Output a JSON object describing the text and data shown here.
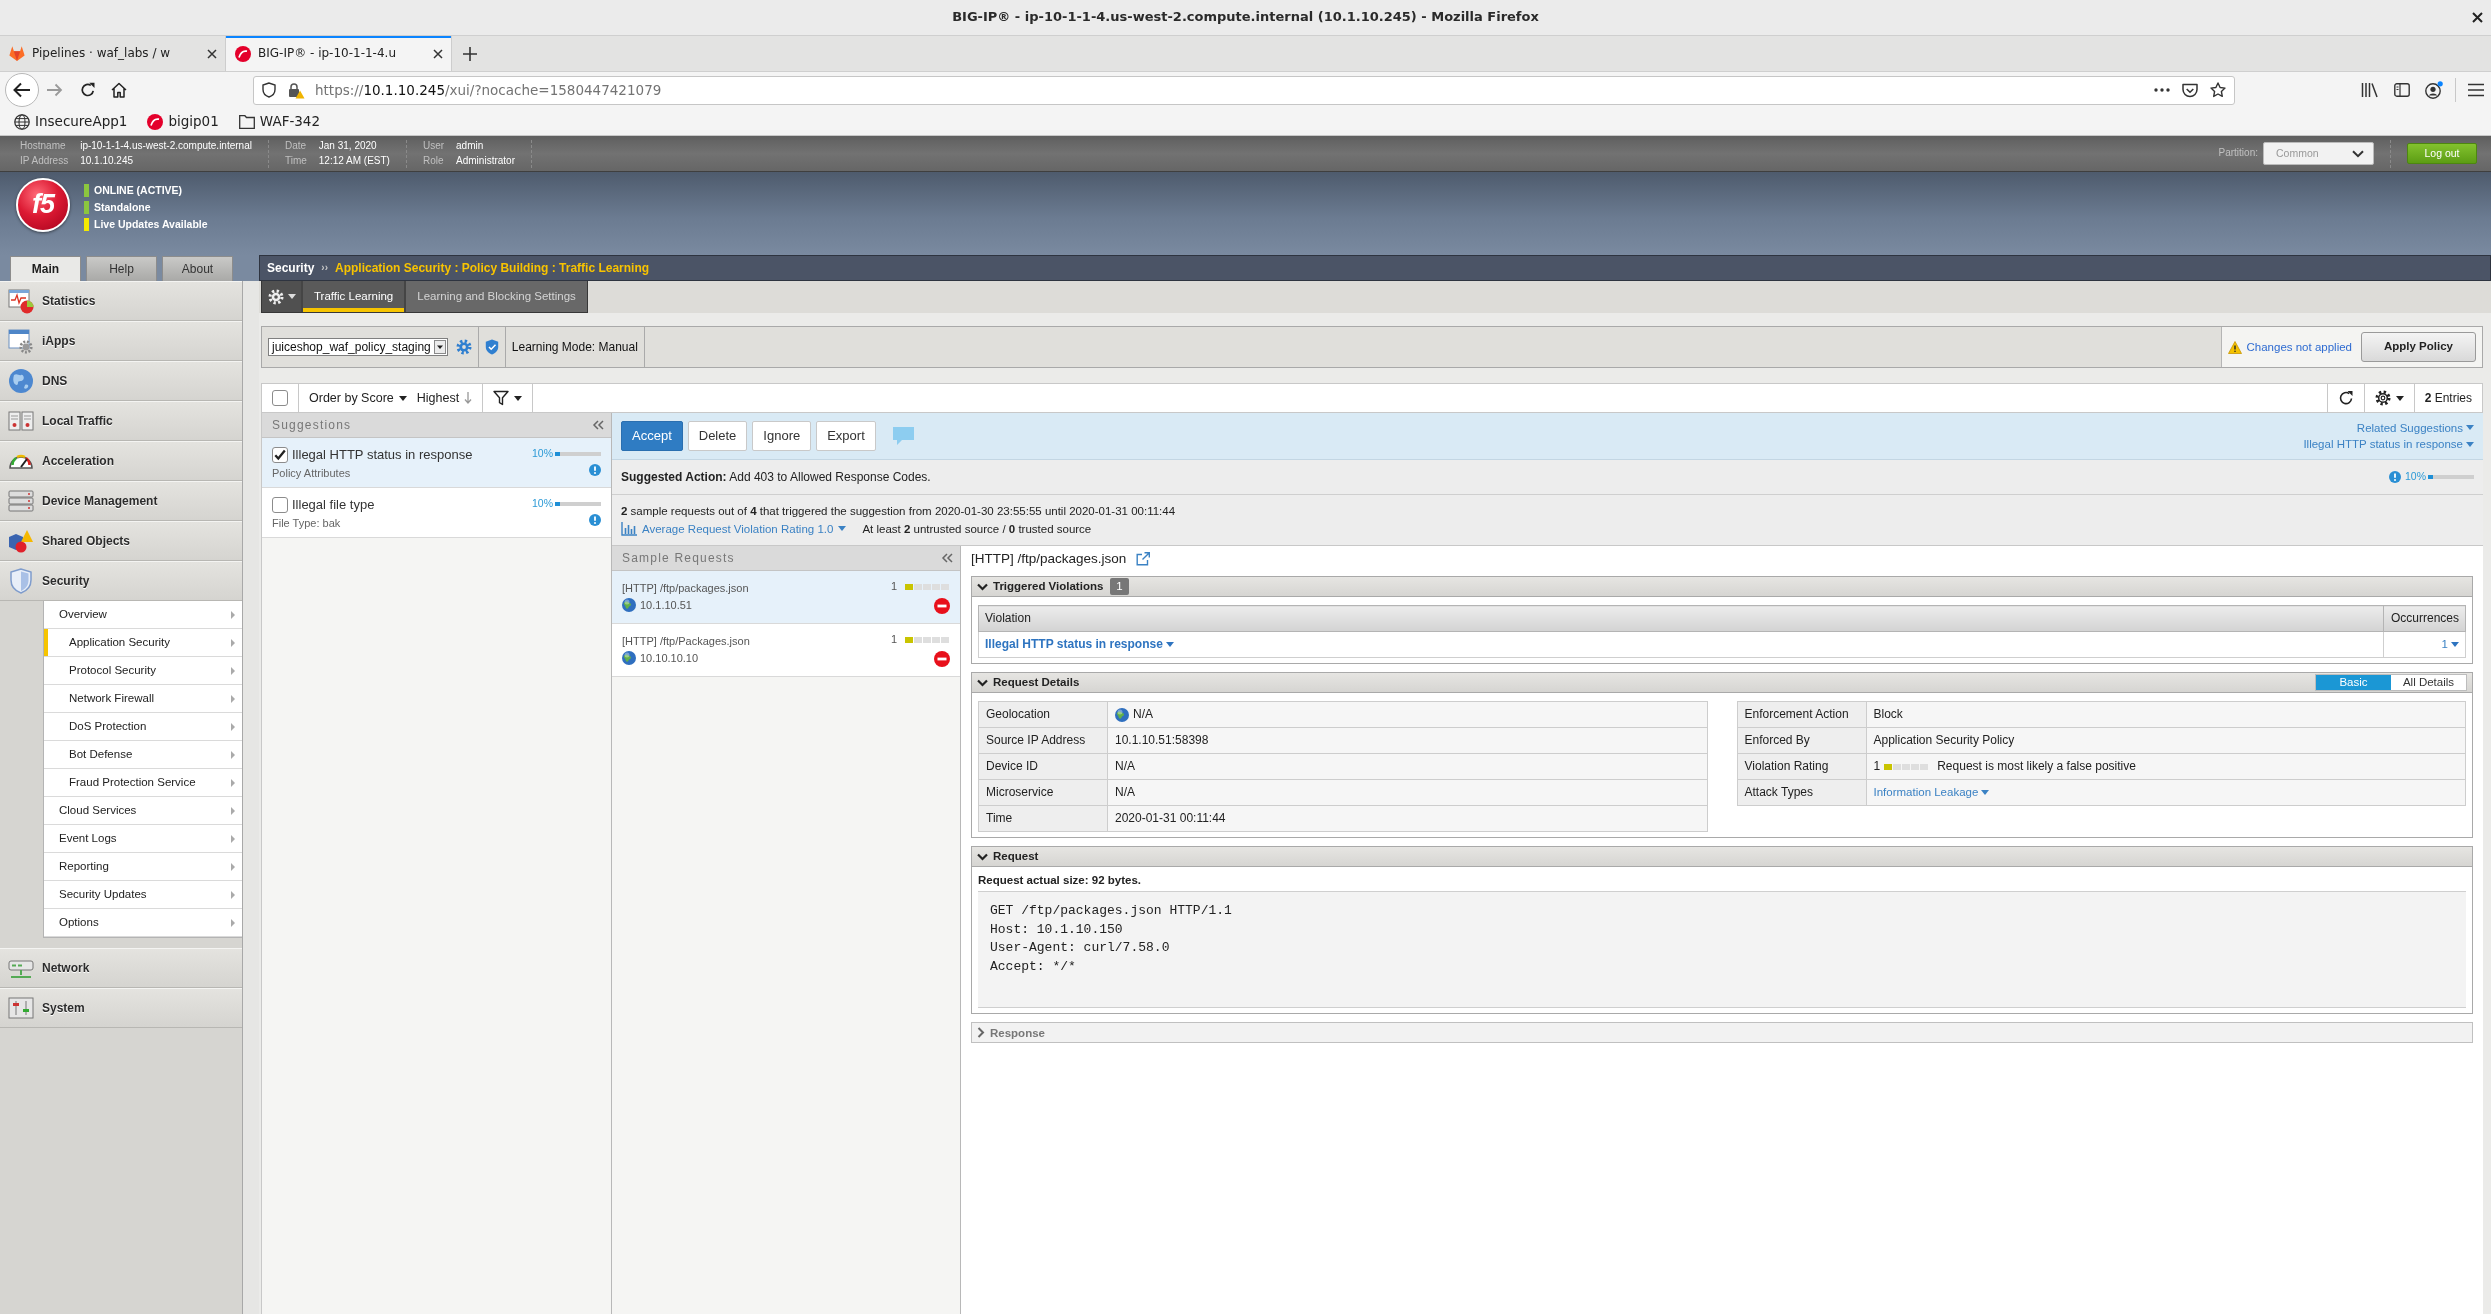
{
  "window": {
    "title": "BIG-IP® - ip-10-1-1-4.us-west-2.compute.internal (10.1.10.245) - Mozilla Firefox"
  },
  "browser": {
    "tabs": [
      {
        "label": "Pipelines · waf_labs / w",
        "selected": false
      },
      {
        "label": "BIG-IP® - ip-10-1-1-4.u",
        "selected": true
      }
    ],
    "address": {
      "scheme": "https://",
      "host": "10.1.10.245",
      "path": "/xui/?nocache=1580447421079"
    },
    "bookmarks": [
      {
        "label": "InsecureApp1"
      },
      {
        "label": "bigip01"
      },
      {
        "label": "WAF-342"
      }
    ]
  },
  "system_bar": {
    "groups": [
      {
        "fields": [
          {
            "label": "Hostname",
            "value": "ip-10-1-1-4.us-west-2.compute.internal"
          },
          {
            "label": "IP Address",
            "value": "10.1.10.245"
          }
        ]
      },
      {
        "fields": [
          {
            "label": "Date",
            "value": "Jan 31, 2020"
          },
          {
            "label": "Time",
            "value": "12:12 AM (EST)"
          }
        ]
      },
      {
        "fields": [
          {
            "label": "User",
            "value": "admin"
          },
          {
            "label": "Role",
            "value": "Administrator"
          }
        ]
      }
    ],
    "partition_label": "Partition:",
    "partition": "Common",
    "logout": "Log out"
  },
  "banner": {
    "logo": "f5",
    "statuses": [
      {
        "label": "ONLINE (ACTIVE)",
        "color": "#8cc63f"
      },
      {
        "label": "Standalone",
        "color": "#8cc63f"
      },
      {
        "label": "Live Updates Available",
        "color": "#f3ea00"
      }
    ]
  },
  "main_tabs": [
    {
      "label": "Main",
      "selected": true
    },
    {
      "label": "Help",
      "selected": false
    },
    {
      "label": "About",
      "selected": false
    }
  ],
  "sidebar": {
    "items": [
      {
        "label": "Statistics"
      },
      {
        "label": "iApps"
      },
      {
        "label": "DNS"
      },
      {
        "label": "Local Traffic"
      },
      {
        "label": "Acceleration"
      },
      {
        "label": "Device Management"
      },
      {
        "label": "Shared Objects"
      },
      {
        "label": "Security",
        "children": [
          {
            "label": "Overview",
            "selected": false,
            "children": [
              {
                "label": "Application Security",
                "selected": true
              },
              {
                "label": "Protocol Security",
                "selected": false
              },
              {
                "label": "Network Firewall",
                "selected": false
              },
              {
                "label": "DoS Protection",
                "selected": false
              },
              {
                "label": "Bot Defense",
                "selected": false
              },
              {
                "label": "Fraud Protection Service",
                "selected": false
              }
            ]
          },
          {
            "label": "Cloud Services",
            "selected": false
          },
          {
            "label": "Event Logs",
            "selected": false
          },
          {
            "label": "Reporting",
            "selected": false
          },
          {
            "label": "Security Updates",
            "selected": false
          },
          {
            "label": "Options",
            "selected": false
          }
        ]
      },
      {
        "label": "Network"
      },
      {
        "label": "System"
      }
    ]
  },
  "breadcrumb": {
    "section": "Security",
    "separator": "››",
    "path": "Application Security : Policy Building : Traffic Learning"
  },
  "sub_tabs": [
    {
      "label": "Traffic Learning",
      "selected": true
    },
    {
      "label": "Learning and Blocking Settings",
      "selected": false
    }
  ],
  "policy_bar": {
    "policy": "juiceshop_waf_policy_staging",
    "learning_mode": "Learning Mode: Manual",
    "warning": "Changes not applied",
    "apply": "Apply Policy"
  },
  "toolbar": {
    "select_all": false,
    "order": "Order by Score",
    "direction": "Highest",
    "entries": "**2** Entries"
  },
  "suggestions": {
    "title": "Suggestions",
    "items": [
      {
        "title": "Illegal HTTP status in response",
        "subtitle": "Policy Attributes",
        "score": "10%",
        "level": 0.1,
        "checked": true,
        "selected": true
      },
      {
        "title": "Illegal file type",
        "subtitle": "File Type: bak",
        "score": "10%",
        "level": 0.1,
        "checked": false,
        "selected": false
      }
    ]
  },
  "suggestion_detail": {
    "actions": [
      {
        "label": "Accept",
        "kind": "primary"
      },
      {
        "label": "Delete",
        "kind": "default"
      },
      {
        "label": "Ignore",
        "kind": "default"
      },
      {
        "label": "Export",
        "kind": "default"
      }
    ],
    "related": [
      "Related Suggestions",
      "Illegal HTTP status in response"
    ],
    "suggested_action": "**Suggested Action:** Add 403 to Allowed Response Codes.",
    "score": "10%",
    "level": 0.1,
    "summary": "**2** sample requests out of **4** that triggered the suggestion from 2020-01-30 23:55:55 until 2020-01-31 00:11:44",
    "rating_link": "Average Request Violation Rating 1.0",
    "sources": "At least **2** untrusted source / **0** trusted source"
  },
  "sample_requests": {
    "title": "Sample Requests",
    "items": [
      {
        "request": "[HTTP] /ftp/packages.json",
        "source_ip": "10.1.10.51",
        "rating": "1",
        "level": 0.2,
        "selected": true
      },
      {
        "request": "[HTTP] /ftp/Packages.json",
        "source_ip": "10.10.10.10",
        "rating": "1",
        "level": 0.2,
        "selected": false
      }
    ]
  },
  "request": {
    "title": "[HTTP] /ftp/packages.json",
    "violations": {
      "title": "Triggered Violations",
      "count": "1",
      "expanded": true,
      "columns": [
        "Violation",
        "Occurrences"
      ],
      "rows": [
        {
          "violation": "Illegal HTTP status in response",
          "occurrences": "1"
        }
      ]
    },
    "details": {
      "title": "Request Details",
      "expanded": true,
      "views": [
        {
          "label": "Basic",
          "selected": true
        },
        {
          "label": "All Details",
          "selected": false
        }
      ],
      "left": [
        {
          "label": "Geolocation",
          "value": "N/A",
          "kind": "geo"
        },
        {
          "label": "Source IP Address",
          "value": "10.1.10.51:58398",
          "kind": "text"
        },
        {
          "label": "Device ID",
          "value": "N/A",
          "kind": "text"
        },
        {
          "label": "Microservice",
          "value": "N/A",
          "kind": "text"
        },
        {
          "label": "Time",
          "value": "2020-01-31 00:11:44",
          "kind": "text"
        }
      ],
      "right": [
        {
          "label": "Enforcement Action",
          "value": "Block",
          "kind": "text"
        },
        {
          "label": "Enforced By",
          "value": "Application Security Policy",
          "kind": "text"
        },
        {
          "label": "Violation Rating",
          "value": "1",
          "kind": "rating",
          "level": 0.2,
          "note": "Request is most likely a false positive"
        },
        {
          "label": "Attack Types",
          "value": "Information Leakage",
          "kind": "link"
        }
      ]
    },
    "raw": {
      "title": "Request",
      "expanded": true,
      "size": "Request actual size: 92 bytes.",
      "lines": [
        "GET /ftp/packages.json HTTP/1.1",
        "Host: 10.1.10.150",
        "User-Agent: curl/7.58.0",
        "Accept: */*"
      ]
    },
    "response": {
      "title": "Response",
      "expanded": false
    }
  }
}
